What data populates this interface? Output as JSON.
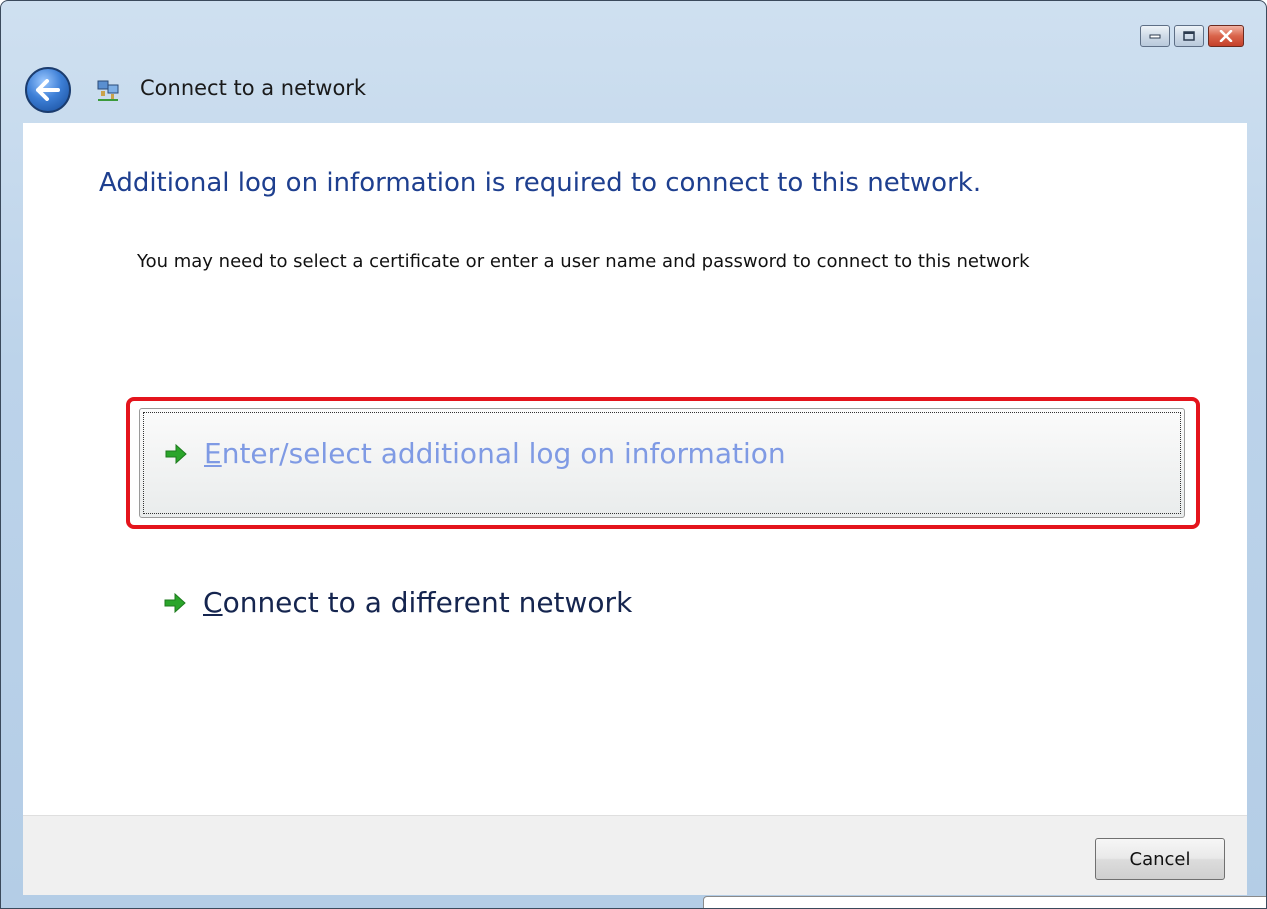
{
  "window": {
    "title": "Connect to a network",
    "controls": {
      "minimize_icon": "minimize-icon",
      "maximize_icon": "maximize-icon",
      "close_icon": "close-icon"
    }
  },
  "page": {
    "heading": "Additional log on information is required to connect to this network.",
    "description": "You may need to select a certificate or enter a user name and password to connect to this network"
  },
  "options": [
    {
      "mnemonic": "E",
      "rest": "nter/select additional log on information",
      "icon": "green-arrow-icon",
      "selected": true
    },
    {
      "mnemonic": "C",
      "rest": "onnect to a different network",
      "icon": "green-arrow-icon",
      "selected": false
    }
  ],
  "footer": {
    "cancel_label": "Cancel"
  },
  "colors": {
    "heading": "#1e3f8f",
    "selected_link_text": "#7f9ae4",
    "highlight_border": "#e4141c",
    "arrow": "#2aa52a"
  }
}
